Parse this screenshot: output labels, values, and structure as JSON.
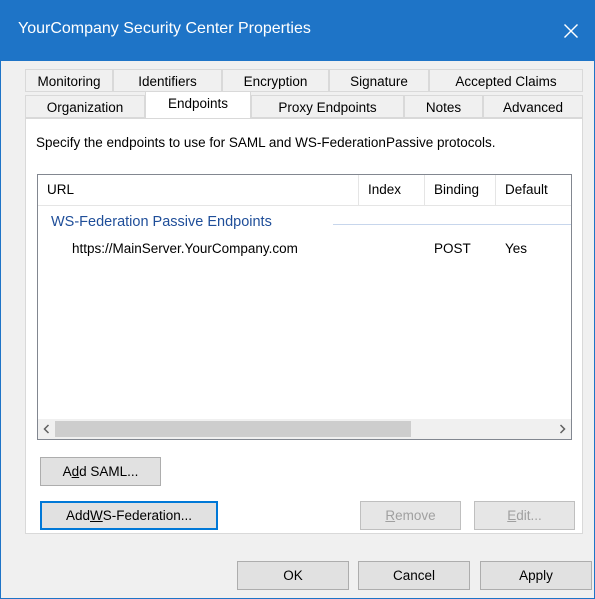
{
  "window": {
    "title": "YourCompany Security Center Properties"
  },
  "tabs": {
    "row1": [
      "Monitoring",
      "Identifiers",
      "Encryption",
      "Signature",
      "Accepted Claims"
    ],
    "row2": [
      "Organization",
      "Endpoints",
      "Proxy Endpoints",
      "Notes",
      "Advanced"
    ],
    "active": "Endpoints"
  },
  "endpoints": {
    "description": "Specify the endpoints to use for SAML and WS-FederationPassive protocols.",
    "columns": [
      "URL",
      "Index",
      "Binding",
      "Default"
    ],
    "group_label": "WS-Federation Passive Endpoints",
    "rows": [
      {
        "url": "https://MainServer.YourCompany.com",
        "index": "",
        "binding": "POST",
        "default": "Yes"
      }
    ]
  },
  "buttons": {
    "add_saml_prefix": "A",
    "add_saml_mnemonic": "d",
    "add_saml_suffix": "d SAML...",
    "add_wsfed_prefix": "Add ",
    "add_wsfed_mnemonic": "W",
    "add_wsfed_suffix": "S-Federation...",
    "remove_mnemonic": "R",
    "remove_suffix": "emove",
    "edit_mnemonic": "E",
    "edit_suffix": "dit...",
    "ok": "OK",
    "cancel": "Cancel",
    "apply": "Apply"
  },
  "icons": {
    "close": "close-icon",
    "scroll_left": "chevron-left-icon",
    "scroll_right": "chevron-right-icon"
  },
  "colors": {
    "titlebar": "#1e74c7",
    "group_text": "#1f4e99",
    "default_button_border": "#0078d7"
  }
}
